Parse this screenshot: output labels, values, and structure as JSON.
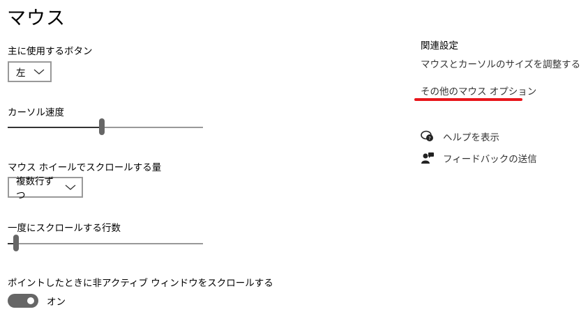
{
  "page": {
    "title": "マウス"
  },
  "primary_button": {
    "label": "主に使用するボタン",
    "value": "左"
  },
  "cursor_speed": {
    "label": "カーソル速度",
    "level": 0.48
  },
  "wheel_scroll": {
    "label": "マウス ホイールでスクロールする量",
    "value": "複数行ずつ"
  },
  "lines_to_scroll": {
    "label": "一度にスクロールする行数",
    "level": 0.03
  },
  "inactive_scroll": {
    "label": "ポイントしたときに非アクティブ ウィンドウをスクロールする",
    "toggle_state": "オン"
  },
  "related": {
    "title": "関連設定",
    "links": [
      "マウスとカーソルのサイズを調整する",
      "その他のマウス オプション"
    ]
  },
  "help": {
    "show_help": "ヘルプを表示",
    "feedback": "フィードバックの送信"
  },
  "colors": {
    "annotation_underline": "#e8151b",
    "toggle_on": "#666666"
  }
}
